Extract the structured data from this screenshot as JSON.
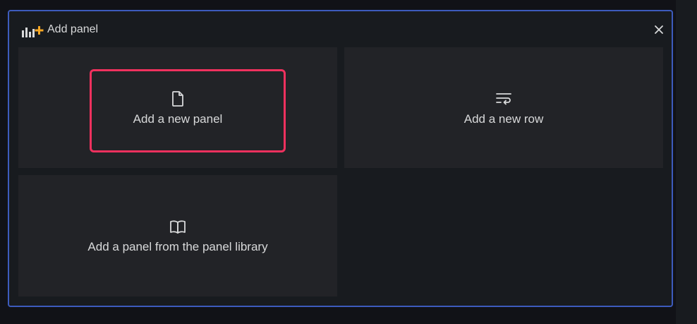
{
  "dialog": {
    "title": "Add panel",
    "title_icon": "add-panel-icon",
    "close_icon": "close-icon"
  },
  "cards": [
    {
      "label": "Add a new panel",
      "icon": "file-icon",
      "highlight_color": "#f0315e"
    },
    {
      "label": "Add a new row",
      "icon": "wrap-text-icon"
    },
    {
      "label": "Add a panel from the panel library",
      "icon": "book-open-icon"
    }
  ],
  "colors": {
    "background": "#111217",
    "panel_background": "#181b1f",
    "card_background": "#222327",
    "panel_border": "#3d5bbd",
    "accent_orange": "#f5a623"
  }
}
